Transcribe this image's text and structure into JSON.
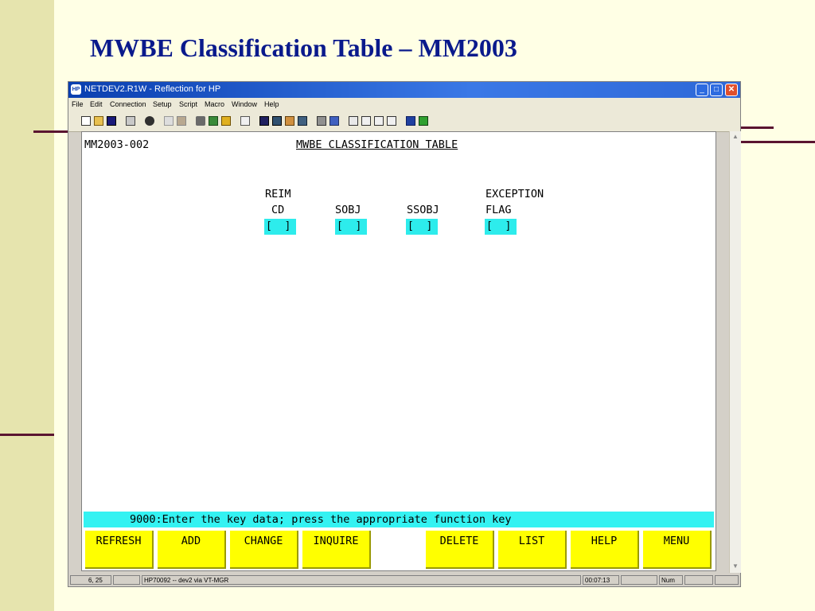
{
  "slide": {
    "title": "MWBE Classification Table – MM2003"
  },
  "window": {
    "title": "NETDEV2.R1W - Reflection for HP",
    "app_icon": "HP",
    "controls": {
      "minimize": "_",
      "maximize": "□",
      "close": "✕"
    },
    "menu": [
      "File",
      "Edit",
      "Connection",
      "Setup",
      "Script",
      "Macro",
      "Window",
      "Help"
    ],
    "toolbar_icons": [
      "new-icon",
      "open-icon",
      "save-icon",
      "print-icon",
      "find-icon",
      "copy-icon",
      "paste-icon",
      "connect-icon",
      "disconnect-icon",
      "settings-icon",
      "macro-icon",
      "display-icon",
      "terminal-icon",
      "keyboard-icon",
      "session-icon",
      "transfer-icon",
      "send-icon",
      "receive-icon",
      "mail-icon",
      "exit-icon",
      "help-icon",
      "book-icon"
    ]
  },
  "screen": {
    "screen_id": "MM2003-002",
    "screen_title": "MWBE CLASSIFICATION TABLE",
    "fields": [
      {
        "label_line1": "REIM",
        "label_line2": "CD",
        "value": "[  ]"
      },
      {
        "label_line1": "",
        "label_line2": "SOBJ",
        "value": "[  ]"
      },
      {
        "label_line1": "",
        "label_line2": "SSOBJ",
        "value": "[  ]"
      },
      {
        "label_line1": "EXCEPTION",
        "label_line2": "FLAG",
        "value": "[  ]"
      }
    ],
    "message": "9000:Enter the key data; press the appropriate function key",
    "function_keys": [
      "REFRESH",
      "ADD",
      "CHANGE",
      "INQUIRE",
      "",
      "DELETE",
      "LIST",
      "HELP",
      "MENU"
    ]
  },
  "status": {
    "cursor": "6, 25",
    "connection": "HP70092 -- dev2 via VT-MGR",
    "time": "00:07:13",
    "numlock": "Num"
  },
  "colors": {
    "slide_title": "#0A1A8C",
    "field_bg": "#2DECEC",
    "message_bg": "#34F2F2",
    "fkey_bg": "#FFFF00",
    "accent_rule": "#5A1430"
  }
}
